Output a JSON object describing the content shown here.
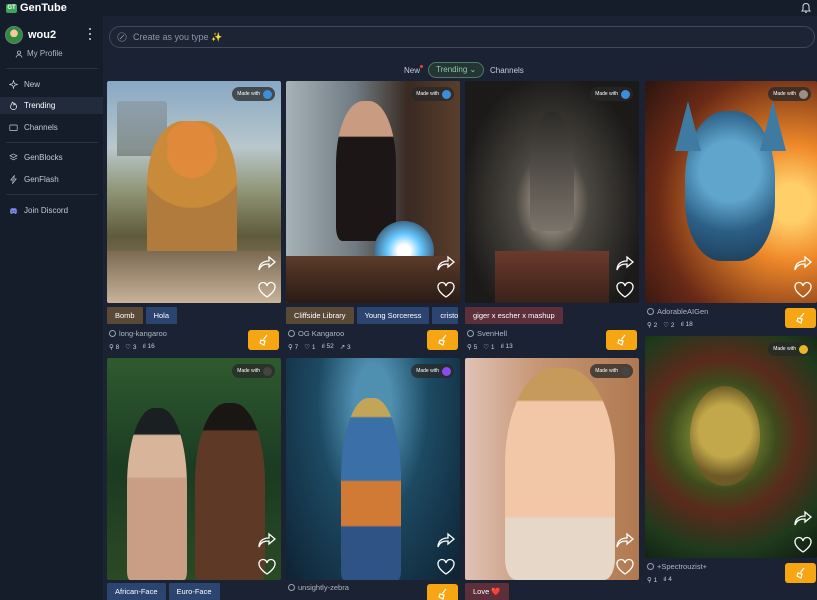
{
  "app": {
    "title": "GenTube",
    "logo_text": "GT"
  },
  "sidebar": {
    "username": "wou2",
    "profile_label": "My Profile",
    "items": [
      {
        "label": "New",
        "icon": "sparkle-icon"
      },
      {
        "label": "Trending",
        "icon": "flame-icon"
      },
      {
        "label": "Channels",
        "icon": "folder-icon"
      },
      {
        "label": "GenBlocks",
        "icon": "layers-icon"
      },
      {
        "label": "GenFlash",
        "icon": "bolt-icon"
      },
      {
        "label": "Join Discord",
        "icon": "discord-icon"
      }
    ]
  },
  "search": {
    "placeholder": "Create as you type ✨"
  },
  "tabs": {
    "new": "New",
    "trending": "Trending",
    "channels": "Channels"
  },
  "made_with": "Made with",
  "colors": {
    "accent": "#f5a612",
    "bg": "#1a2233",
    "sidebar": "#151d2b",
    "tag_brown": "#5b4938",
    "tag_blue": "#2c4470"
  },
  "cards": [
    {
      "tags": [
        "Bomb",
        "Hola"
      ],
      "author": "long-kangaroo",
      "stats": [
        "8",
        "3",
        "16"
      ]
    },
    {
      "tags": [
        "Cliffside Library",
        "Young Sorceress",
        "cristo"
      ],
      "author": "OG Kangaroo",
      "stats": [
        "7",
        "1",
        "52",
        "3"
      ]
    },
    {
      "tags": [
        "giger x escher x mashup"
      ],
      "author": "SvenHell",
      "stats": [
        "5",
        "1",
        "13"
      ]
    },
    {
      "author": "AdorableAIGen",
      "stats": [
        "2",
        "2",
        "18"
      ]
    },
    {
      "tags": [
        "African-Face",
        "Euro-Face"
      ]
    },
    {
      "author": "unsightly-zebra"
    },
    {
      "tags": [
        "Love ❤️"
      ]
    },
    {
      "author": "+Spectrouzist+",
      "stats": [
        "1",
        "4"
      ]
    }
  ]
}
